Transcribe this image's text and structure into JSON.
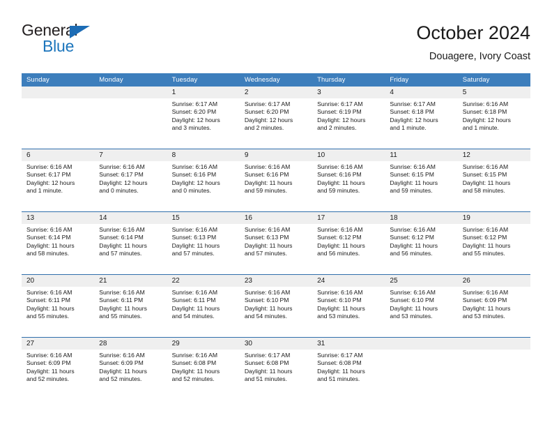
{
  "brand": {
    "name_part1": "General",
    "name_part2": "Blue",
    "triangle_color": "#1c6cb5",
    "blue_color": "#1c75bc"
  },
  "header": {
    "title": "October 2024",
    "subtitle": "Douagere, Ivory Coast"
  },
  "theme": {
    "header_row_bg": "#3d7ebc",
    "row_divider": "#2f6eab",
    "daynum_band_bg": "#efefef",
    "text": "#1a1a1a"
  },
  "weekdays": [
    "Sunday",
    "Monday",
    "Tuesday",
    "Wednesday",
    "Thursday",
    "Friday",
    "Saturday"
  ],
  "weeks": [
    [
      {
        "day": "",
        "lines": []
      },
      {
        "day": "",
        "lines": []
      },
      {
        "day": "1",
        "lines": [
          "Sunrise: 6:17 AM",
          "Sunset: 6:20 PM",
          "Daylight: 12 hours",
          "and 3 minutes."
        ]
      },
      {
        "day": "2",
        "lines": [
          "Sunrise: 6:17 AM",
          "Sunset: 6:20 PM",
          "Daylight: 12 hours",
          "and 2 minutes."
        ]
      },
      {
        "day": "3",
        "lines": [
          "Sunrise: 6:17 AM",
          "Sunset: 6:19 PM",
          "Daylight: 12 hours",
          "and 2 minutes."
        ]
      },
      {
        "day": "4",
        "lines": [
          "Sunrise: 6:17 AM",
          "Sunset: 6:18 PM",
          "Daylight: 12 hours",
          "and 1 minute."
        ]
      },
      {
        "day": "5",
        "lines": [
          "Sunrise: 6:16 AM",
          "Sunset: 6:18 PM",
          "Daylight: 12 hours",
          "and 1 minute."
        ]
      }
    ],
    [
      {
        "day": "6",
        "lines": [
          "Sunrise: 6:16 AM",
          "Sunset: 6:17 PM",
          "Daylight: 12 hours",
          "and 1 minute."
        ]
      },
      {
        "day": "7",
        "lines": [
          "Sunrise: 6:16 AM",
          "Sunset: 6:17 PM",
          "Daylight: 12 hours",
          "and 0 minutes."
        ]
      },
      {
        "day": "8",
        "lines": [
          "Sunrise: 6:16 AM",
          "Sunset: 6:16 PM",
          "Daylight: 12 hours",
          "and 0 minutes."
        ]
      },
      {
        "day": "9",
        "lines": [
          "Sunrise: 6:16 AM",
          "Sunset: 6:16 PM",
          "Daylight: 11 hours",
          "and 59 minutes."
        ]
      },
      {
        "day": "10",
        "lines": [
          "Sunrise: 6:16 AM",
          "Sunset: 6:16 PM",
          "Daylight: 11 hours",
          "and 59 minutes."
        ]
      },
      {
        "day": "11",
        "lines": [
          "Sunrise: 6:16 AM",
          "Sunset: 6:15 PM",
          "Daylight: 11 hours",
          "and 59 minutes."
        ]
      },
      {
        "day": "12",
        "lines": [
          "Sunrise: 6:16 AM",
          "Sunset: 6:15 PM",
          "Daylight: 11 hours",
          "and 58 minutes."
        ]
      }
    ],
    [
      {
        "day": "13",
        "lines": [
          "Sunrise: 6:16 AM",
          "Sunset: 6:14 PM",
          "Daylight: 11 hours",
          "and 58 minutes."
        ]
      },
      {
        "day": "14",
        "lines": [
          "Sunrise: 6:16 AM",
          "Sunset: 6:14 PM",
          "Daylight: 11 hours",
          "and 57 minutes."
        ]
      },
      {
        "day": "15",
        "lines": [
          "Sunrise: 6:16 AM",
          "Sunset: 6:13 PM",
          "Daylight: 11 hours",
          "and 57 minutes."
        ]
      },
      {
        "day": "16",
        "lines": [
          "Sunrise: 6:16 AM",
          "Sunset: 6:13 PM",
          "Daylight: 11 hours",
          "and 57 minutes."
        ]
      },
      {
        "day": "17",
        "lines": [
          "Sunrise: 6:16 AM",
          "Sunset: 6:12 PM",
          "Daylight: 11 hours",
          "and 56 minutes."
        ]
      },
      {
        "day": "18",
        "lines": [
          "Sunrise: 6:16 AM",
          "Sunset: 6:12 PM",
          "Daylight: 11 hours",
          "and 56 minutes."
        ]
      },
      {
        "day": "19",
        "lines": [
          "Sunrise: 6:16 AM",
          "Sunset: 6:12 PM",
          "Daylight: 11 hours",
          "and 55 minutes."
        ]
      }
    ],
    [
      {
        "day": "20",
        "lines": [
          "Sunrise: 6:16 AM",
          "Sunset: 6:11 PM",
          "Daylight: 11 hours",
          "and 55 minutes."
        ]
      },
      {
        "day": "21",
        "lines": [
          "Sunrise: 6:16 AM",
          "Sunset: 6:11 PM",
          "Daylight: 11 hours",
          "and 55 minutes."
        ]
      },
      {
        "day": "22",
        "lines": [
          "Sunrise: 6:16 AM",
          "Sunset: 6:11 PM",
          "Daylight: 11 hours",
          "and 54 minutes."
        ]
      },
      {
        "day": "23",
        "lines": [
          "Sunrise: 6:16 AM",
          "Sunset: 6:10 PM",
          "Daylight: 11 hours",
          "and 54 minutes."
        ]
      },
      {
        "day": "24",
        "lines": [
          "Sunrise: 6:16 AM",
          "Sunset: 6:10 PM",
          "Daylight: 11 hours",
          "and 53 minutes."
        ]
      },
      {
        "day": "25",
        "lines": [
          "Sunrise: 6:16 AM",
          "Sunset: 6:10 PM",
          "Daylight: 11 hours",
          "and 53 minutes."
        ]
      },
      {
        "day": "26",
        "lines": [
          "Sunrise: 6:16 AM",
          "Sunset: 6:09 PM",
          "Daylight: 11 hours",
          "and 53 minutes."
        ]
      }
    ],
    [
      {
        "day": "27",
        "lines": [
          "Sunrise: 6:16 AM",
          "Sunset: 6:09 PM",
          "Daylight: 11 hours",
          "and 52 minutes."
        ]
      },
      {
        "day": "28",
        "lines": [
          "Sunrise: 6:16 AM",
          "Sunset: 6:09 PM",
          "Daylight: 11 hours",
          "and 52 minutes."
        ]
      },
      {
        "day": "29",
        "lines": [
          "Sunrise: 6:16 AM",
          "Sunset: 6:08 PM",
          "Daylight: 11 hours",
          "and 52 minutes."
        ]
      },
      {
        "day": "30",
        "lines": [
          "Sunrise: 6:17 AM",
          "Sunset: 6:08 PM",
          "Daylight: 11 hours",
          "and 51 minutes."
        ]
      },
      {
        "day": "31",
        "lines": [
          "Sunrise: 6:17 AM",
          "Sunset: 6:08 PM",
          "Daylight: 11 hours",
          "and 51 minutes."
        ]
      },
      {
        "day": "",
        "lines": []
      },
      {
        "day": "",
        "lines": []
      }
    ]
  ]
}
